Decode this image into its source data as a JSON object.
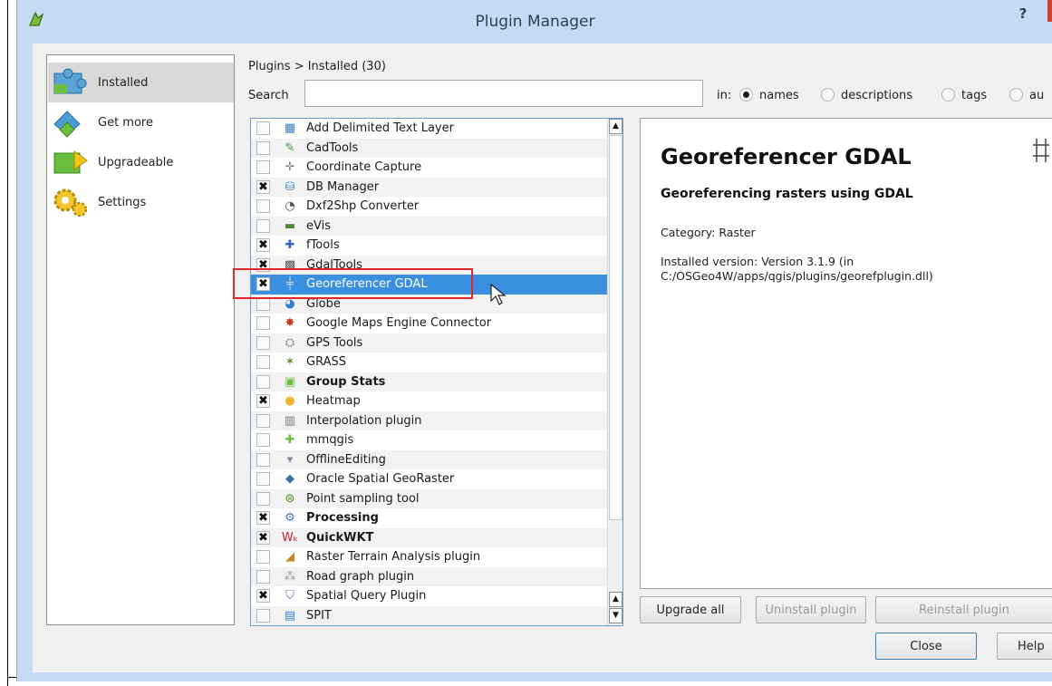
{
  "window": {
    "title": "Plugin Manager",
    "help_label": "?"
  },
  "sidebar": {
    "items": [
      {
        "label": "Installed",
        "icon": "puzzle-installed-icon"
      },
      {
        "label": "Get more",
        "icon": "puzzle-get-more-icon"
      },
      {
        "label": "Upgradeable",
        "icon": "puzzle-upgrade-icon"
      },
      {
        "label": "Settings",
        "icon": "gears-settings-icon"
      }
    ]
  },
  "breadcrumb": "Plugins > Installed (30)",
  "search": {
    "label": "Search",
    "value": "",
    "in_label": "in:",
    "options": [
      {
        "label": "names",
        "selected": true
      },
      {
        "label": "descriptions",
        "selected": false
      },
      {
        "label": "tags",
        "selected": false
      },
      {
        "label": "au",
        "selected": false
      }
    ]
  },
  "plugins": [
    {
      "name": "Add Delimited Text Layer",
      "checked": false,
      "bold": false,
      "icon": "delimited-text-icon"
    },
    {
      "name": "CadTools",
      "checked": false,
      "bold": false,
      "icon": "cadtools-icon"
    },
    {
      "name": "Coordinate Capture",
      "checked": false,
      "bold": false,
      "icon": "crosshair-icon"
    },
    {
      "name": "DB Manager",
      "checked": true,
      "bold": false,
      "icon": "database-icon"
    },
    {
      "name": "Dxf2Shp Converter",
      "checked": false,
      "bold": false,
      "icon": "dxf-icon"
    },
    {
      "name": "eVis",
      "checked": false,
      "bold": false,
      "icon": "evis-icon"
    },
    {
      "name": "fTools",
      "checked": true,
      "bold": false,
      "icon": "ftools-icon"
    },
    {
      "name": "GdalTools",
      "checked": true,
      "bold": false,
      "icon": "gdaltools-icon"
    },
    {
      "name": "Georeferencer GDAL",
      "checked": true,
      "bold": false,
      "icon": "georeferencer-icon",
      "selected": true
    },
    {
      "name": "Globe",
      "checked": false,
      "bold": false,
      "icon": "globe-icon"
    },
    {
      "name": "Google Maps Engine Connector",
      "checked": false,
      "bold": false,
      "icon": "google-maps-icon"
    },
    {
      "name": "GPS Tools",
      "checked": false,
      "bold": false,
      "icon": "gps-icon"
    },
    {
      "name": "GRASS",
      "checked": false,
      "bold": false,
      "icon": "grass-icon"
    },
    {
      "name": "Group Stats",
      "checked": false,
      "bold": true,
      "icon": "group-stats-icon"
    },
    {
      "name": "Heatmap",
      "checked": true,
      "bold": false,
      "icon": "heatmap-icon"
    },
    {
      "name": "Interpolation plugin",
      "checked": false,
      "bold": false,
      "icon": "interpolation-icon"
    },
    {
      "name": "mmqgis",
      "checked": false,
      "bold": false,
      "icon": "mmqgis-icon"
    },
    {
      "name": "OfflineEditing",
      "checked": false,
      "bold": false,
      "icon": "offline-editing-icon"
    },
    {
      "name": "Oracle Spatial GeoRaster",
      "checked": false,
      "bold": false,
      "icon": "oracle-icon"
    },
    {
      "name": "Point sampling tool",
      "checked": false,
      "bold": false,
      "icon": "point-sampling-icon"
    },
    {
      "name": "Processing",
      "checked": true,
      "bold": true,
      "icon": "processing-gear-icon"
    },
    {
      "name": "QuickWKT",
      "checked": true,
      "bold": true,
      "icon": "quickwkt-icon"
    },
    {
      "name": "Raster Terrain Analysis plugin",
      "checked": false,
      "bold": false,
      "icon": "terrain-icon"
    },
    {
      "name": "Road graph plugin",
      "checked": false,
      "bold": false,
      "icon": "road-graph-icon"
    },
    {
      "name": "Spatial Query Plugin",
      "checked": true,
      "bold": false,
      "icon": "spatial-query-icon"
    },
    {
      "name": "SPIT",
      "checked": false,
      "bold": false,
      "icon": "spit-icon"
    }
  ],
  "detail": {
    "title": "Georeferencer GDAL",
    "subtitle": "Georeferencing rasters using GDAL",
    "category": "Category: Raster",
    "installed_version": "Installed version: Version 3.1.9 (in C:/OSGeo4W/apps/qgis/plugins/georefplugin.dll)"
  },
  "buttons": {
    "upgrade_all": "Upgrade all",
    "uninstall": "Uninstall plugin",
    "reinstall": "Reinstall plugin",
    "close": "Close",
    "help": "Help"
  },
  "colors": {
    "selection": "#3b8fe0",
    "highlight_box": "#e0262a",
    "window_frame": "#c6dbf1"
  }
}
